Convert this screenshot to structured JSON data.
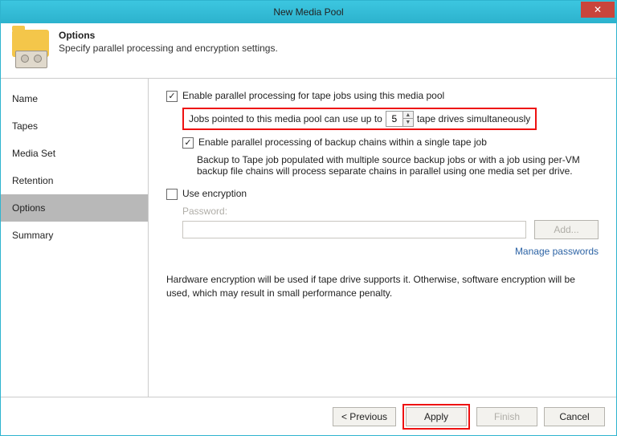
{
  "window": {
    "title": "New Media Pool"
  },
  "header": {
    "title": "Options",
    "subtitle": "Specify parallel processing and encryption settings."
  },
  "sidebar": {
    "items": [
      {
        "label": "Name"
      },
      {
        "label": "Tapes"
      },
      {
        "label": "Media Set"
      },
      {
        "label": "Retention"
      },
      {
        "label": "Options"
      },
      {
        "label": "Summary"
      }
    ]
  },
  "content": {
    "enable_parallel_label": "Enable parallel processing for tape jobs using this media pool",
    "jobs_prefix": "Jobs pointed to this media pool can use up to",
    "drives_value": "5",
    "jobs_suffix": "tape drives simultaneously",
    "enable_chains_label": "Enable parallel processing of backup chains within a single tape job",
    "chains_desc": "Backup to Tape job populated with multiple source backup jobs or with a job using per-VM backup file chains will process separate chains in parallel using one media set per drive.",
    "encryption_label": "Use encryption",
    "password_label": "Password:",
    "add_button": "Add...",
    "manage_link": "Manage passwords",
    "hw_note": "Hardware encryption will be used if tape drive supports it. Otherwise, software encryption will be used, which may result in small performance penalty."
  },
  "footer": {
    "previous": "< Previous",
    "apply": "Apply",
    "finish": "Finish",
    "cancel": "Cancel"
  }
}
